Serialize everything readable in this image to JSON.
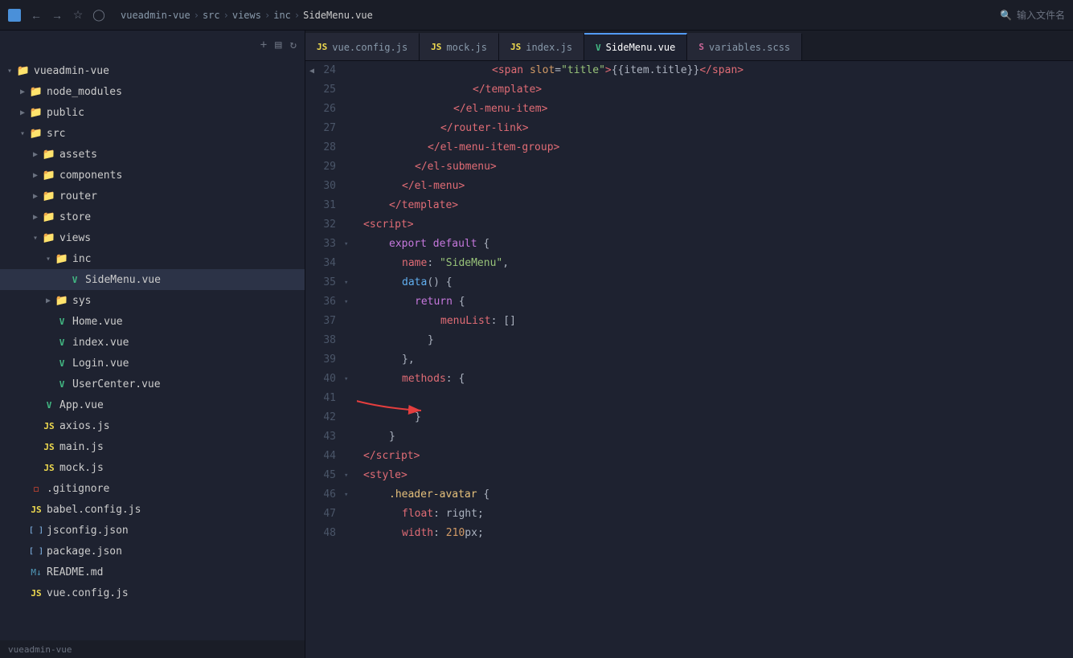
{
  "topbar": {
    "breadcrumb": [
      "vueadmin-vue",
      "src",
      "views",
      "inc",
      "SideMenu.vue"
    ],
    "search_placeholder": "输入文件名",
    "nav_buttons": [
      "←",
      "→",
      "☆",
      "⊙"
    ]
  },
  "sidebar": {
    "root": "vueadmin-vue",
    "items": [
      {
        "id": "vueadmin-vue",
        "label": "vueadmin-vue",
        "type": "folder",
        "level": 0,
        "open": true
      },
      {
        "id": "node_modules",
        "label": "node_modules",
        "type": "folder",
        "level": 1,
        "open": false
      },
      {
        "id": "public",
        "label": "public",
        "type": "folder",
        "level": 1,
        "open": false
      },
      {
        "id": "src",
        "label": "src",
        "type": "folder",
        "level": 1,
        "open": true
      },
      {
        "id": "assets",
        "label": "assets",
        "type": "folder",
        "level": 2,
        "open": false
      },
      {
        "id": "components",
        "label": "components",
        "type": "folder",
        "level": 2,
        "open": false
      },
      {
        "id": "router",
        "label": "router",
        "type": "folder",
        "level": 2,
        "open": false
      },
      {
        "id": "store",
        "label": "store",
        "type": "folder",
        "level": 2,
        "open": false
      },
      {
        "id": "views",
        "label": "views",
        "type": "folder",
        "level": 2,
        "open": true
      },
      {
        "id": "inc",
        "label": "inc",
        "type": "folder",
        "level": 3,
        "open": true
      },
      {
        "id": "SideMenu.vue",
        "label": "SideMenu.vue",
        "type": "vue",
        "level": 4,
        "open": false,
        "active": true
      },
      {
        "id": "sys",
        "label": "sys",
        "type": "folder",
        "level": 3,
        "open": false
      },
      {
        "id": "Home.vue",
        "label": "Home.vue",
        "type": "vue",
        "level": 3
      },
      {
        "id": "index.vue",
        "label": "index.vue",
        "type": "vue",
        "level": 3
      },
      {
        "id": "Login.vue",
        "label": "Login.vue",
        "type": "vue",
        "level": 3
      },
      {
        "id": "UserCenter.vue",
        "label": "UserCenter.vue",
        "type": "vue",
        "level": 3
      },
      {
        "id": "App.vue",
        "label": "App.vue",
        "type": "vue",
        "level": 2
      },
      {
        "id": "axios.js",
        "label": "axios.js",
        "type": "js",
        "level": 2
      },
      {
        "id": "main.js",
        "label": "main.js",
        "type": "js",
        "level": 2
      },
      {
        "id": "mock.js",
        "label": "mock.js",
        "type": "js",
        "level": 2
      },
      {
        "id": "gitignore",
        "label": ".gitignore",
        "type": "git",
        "level": 1
      },
      {
        "id": "babel.config.js",
        "label": "babel.config.js",
        "type": "js",
        "level": 1
      },
      {
        "id": "jsconfig.json",
        "label": "jsconfig.json",
        "type": "json",
        "level": 1
      },
      {
        "id": "package.json",
        "label": "package.json",
        "type": "json",
        "level": 1
      },
      {
        "id": "README.md",
        "label": "README.md",
        "type": "md",
        "level": 1
      },
      {
        "id": "vue.config.js",
        "label": "vue.config.js",
        "type": "js",
        "level": 1
      }
    ]
  },
  "tabs": [
    {
      "label": "vue.config.js",
      "type": "js",
      "active": false
    },
    {
      "label": "mock.js",
      "type": "js",
      "active": false
    },
    {
      "label": "index.js",
      "type": "js",
      "active": false
    },
    {
      "label": "SideMenu.vue",
      "type": "vue",
      "active": true
    },
    {
      "label": "variables.scss",
      "type": "scss",
      "active": false
    }
  ],
  "statusbar": {
    "text": "vueadmin-vue"
  },
  "code_lines": [
    {
      "num": 24,
      "content": "html_24"
    },
    {
      "num": 25,
      "content": "html_25"
    },
    {
      "num": 26,
      "content": "html_26"
    },
    {
      "num": 27,
      "content": "html_27"
    },
    {
      "num": 28,
      "content": "html_28"
    },
    {
      "num": 29,
      "content": "html_29"
    },
    {
      "num": 30,
      "content": "html_30"
    },
    {
      "num": 31,
      "content": "html_31"
    },
    {
      "num": 32,
      "content": "html_32"
    },
    {
      "num": 33,
      "content": "html_33"
    },
    {
      "num": 34,
      "content": "html_34"
    },
    {
      "num": 35,
      "content": "html_35"
    },
    {
      "num": 36,
      "content": "html_36"
    },
    {
      "num": 37,
      "content": "html_37"
    },
    {
      "num": 38,
      "content": "html_38"
    },
    {
      "num": 39,
      "content": "html_39"
    },
    {
      "num": 40,
      "content": "html_40"
    },
    {
      "num": 41,
      "content": "html_41"
    },
    {
      "num": 42,
      "content": "html_42"
    },
    {
      "num": 43,
      "content": "html_43"
    },
    {
      "num": 44,
      "content": "html_44"
    },
    {
      "num": 45,
      "content": "html_45"
    },
    {
      "num": 46,
      "content": "html_46"
    },
    {
      "num": 47,
      "content": "html_47"
    },
    {
      "num": 48,
      "content": "html_48"
    }
  ]
}
